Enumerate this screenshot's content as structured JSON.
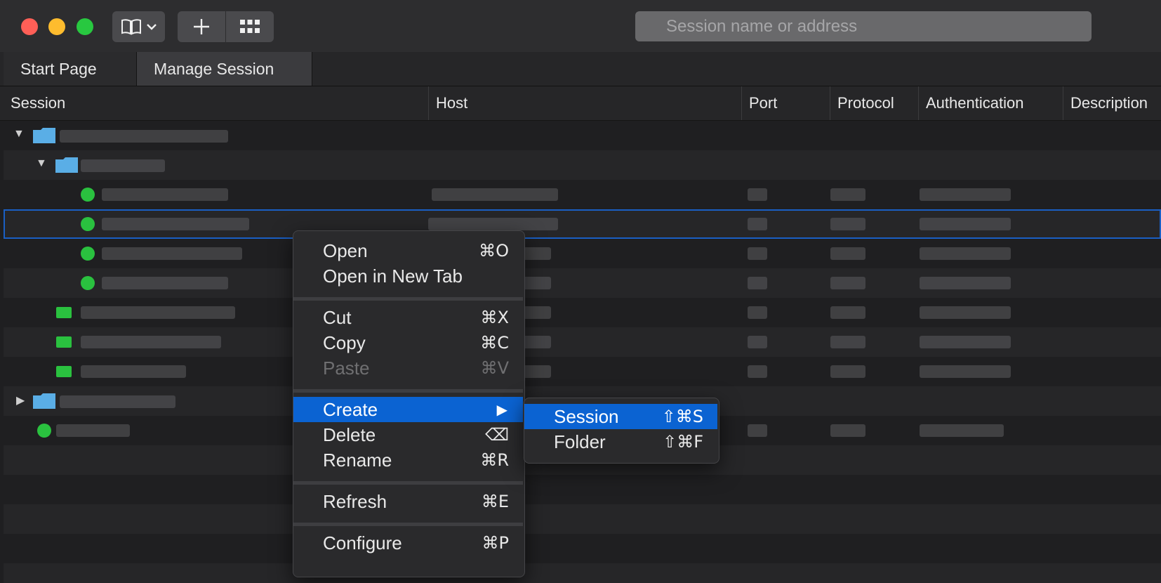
{
  "toolbar": {
    "search_placeholder": "Session name or address",
    "book_icon": "book-icon",
    "add_icon": "plus-icon",
    "grid_icon": "grid-icon"
  },
  "tabs": [
    {
      "label": "Start Page"
    },
    {
      "label": "Manage Session"
    }
  ],
  "columns": [
    "Session",
    "Host",
    "Port",
    "Protocol",
    "Authentication",
    "Description"
  ],
  "context_menu": {
    "items": [
      {
        "label": "Open",
        "shortcut": "⌘O"
      },
      {
        "label": "Open in New Tab",
        "shortcut": ""
      },
      {
        "label": "Cut",
        "shortcut": "⌘X"
      },
      {
        "label": "Copy",
        "shortcut": "⌘C"
      },
      {
        "label": "Paste",
        "shortcut": "⌘V"
      },
      {
        "label": "Create",
        "shortcut": "▶"
      },
      {
        "label": "Delete",
        "shortcut": "⌫"
      },
      {
        "label": "Rename",
        "shortcut": "⌘R"
      },
      {
        "label": "Refresh",
        "shortcut": "⌘E"
      },
      {
        "label": "Configure",
        "shortcut": "⌘P"
      }
    ],
    "submenu": [
      {
        "label": "Session",
        "shortcut": "⇧⌘S"
      },
      {
        "label": "Folder",
        "shortcut": "⇧⌘F"
      }
    ]
  },
  "colors": {
    "accent": "#0b63d2",
    "status_online": "#2ac13f",
    "folder": "#5aaee6"
  }
}
